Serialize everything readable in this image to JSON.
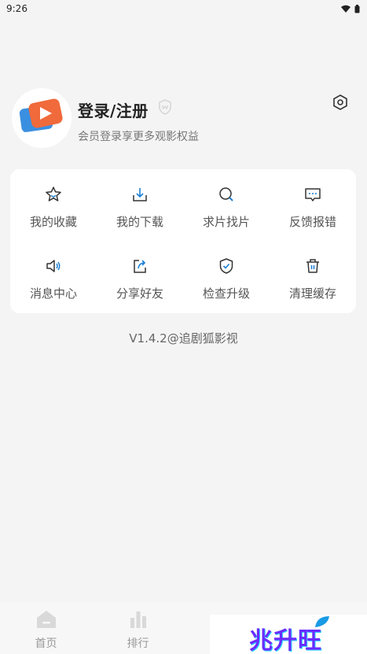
{
  "status": {
    "time": "9:26"
  },
  "profile": {
    "title": "登录/注册",
    "subtitle": "会员登录享更多观影权益"
  },
  "menu": {
    "items": [
      {
        "label": "我的收藏",
        "icon": "star-icon"
      },
      {
        "label": "我的下载",
        "icon": "download-icon"
      },
      {
        "label": "求片找片",
        "icon": "search-icon"
      },
      {
        "label": "反馈报错",
        "icon": "feedback-icon"
      },
      {
        "label": "消息中心",
        "icon": "speaker-icon"
      },
      {
        "label": "分享好友",
        "icon": "share-icon"
      },
      {
        "label": "检查升级",
        "icon": "shield-check-icon"
      },
      {
        "label": "清理缓存",
        "icon": "trash-icon"
      }
    ]
  },
  "version": "V1.4.2@追剧狐影视",
  "nav": {
    "items": [
      {
        "label": "首页",
        "icon": "home-icon"
      },
      {
        "label": "排行",
        "icon": "rank-icon"
      }
    ]
  },
  "watermark": {
    "text": "兆升旺"
  },
  "colors": {
    "accent": "#1a7fd4",
    "brand_orange": "#f06a3c"
  }
}
